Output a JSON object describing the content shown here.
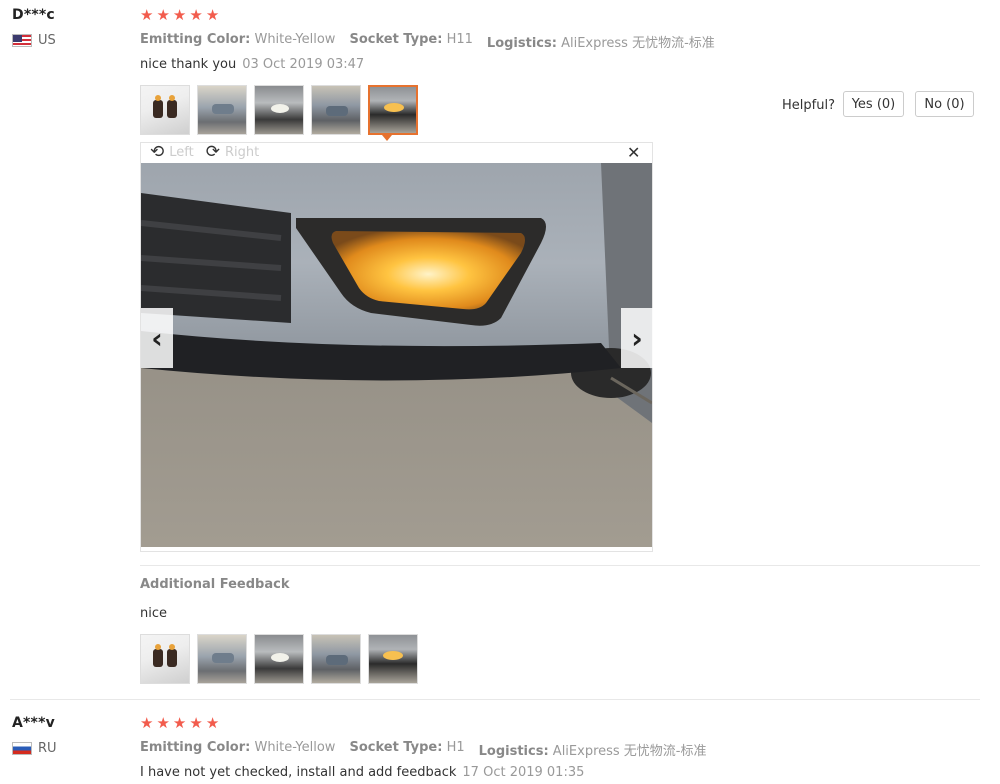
{
  "review1": {
    "user": "D***c",
    "country": "US",
    "stars": 5,
    "attributes": [
      {
        "key": "Emitting Color:",
        "value": "White-Yellow"
      },
      {
        "key": "Socket Type:",
        "value": "H11"
      },
      {
        "key": "Logistics:",
        "value": "AliExpress 无忧物流-标准"
      }
    ],
    "text": "nice thank you",
    "date": "03 Oct 2019 03:47",
    "helpful_label": "Helpful?",
    "yes_label": "Yes (0)",
    "no_label": "No (0)",
    "viewer": {
      "left_label": "Left",
      "right_label": "Right",
      "close_icon": "close-icon",
      "prev_icon": "chevron-left-icon",
      "next_icon": "chevron-right-icon"
    },
    "additional_feedback": {
      "title": "Additional Feedback",
      "text": "nice"
    }
  },
  "review2": {
    "user": "A***v",
    "country": "RU",
    "stars": 5,
    "attributes": [
      {
        "key": "Emitting Color:",
        "value": "White-Yellow"
      },
      {
        "key": "Socket Type:",
        "value": "H1"
      },
      {
        "key": "Logistics:",
        "value": "AliExpress 无忧物流-标准"
      }
    ],
    "text": "I have not yet checked, install and add feedback",
    "date": "17 Oct 2019 01:35"
  },
  "colors": {
    "star": "#f25c4d",
    "selected_border": "#e6722f"
  }
}
